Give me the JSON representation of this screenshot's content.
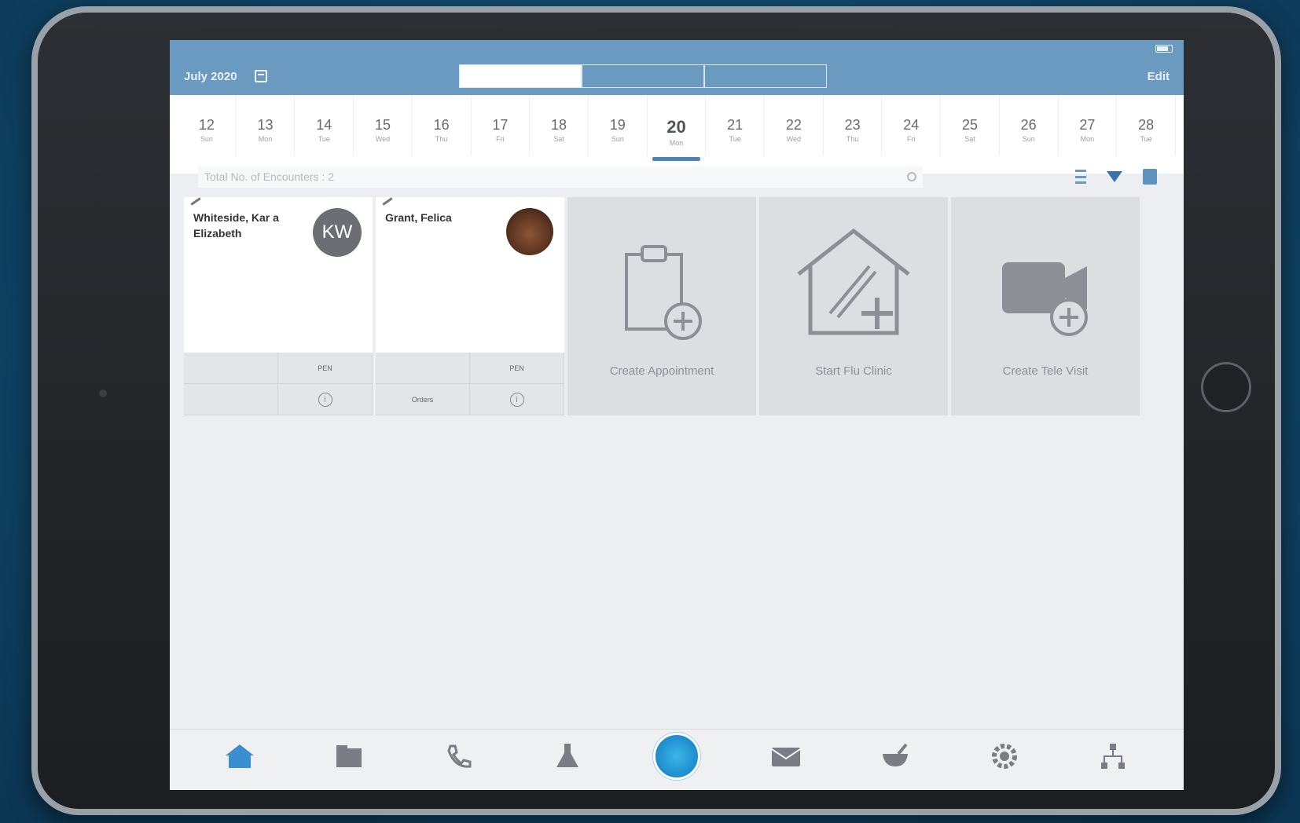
{
  "status_bar": {
    "time": "",
    "carrier": "",
    "battery": ""
  },
  "nav": {
    "title": "July 2020",
    "edit_label": "Edit",
    "segments": [
      "",
      "",
      ""
    ]
  },
  "dates": [
    {
      "num": "12",
      "day": "Sun"
    },
    {
      "num": "13",
      "day": "Mon"
    },
    {
      "num": "14",
      "day": "Tue"
    },
    {
      "num": "15",
      "day": "Wed"
    },
    {
      "num": "16",
      "day": "Thu"
    },
    {
      "num": "17",
      "day": "Fri"
    },
    {
      "num": "18",
      "day": "Sat"
    },
    {
      "num": "19",
      "day": "Sun"
    },
    {
      "num": "20",
      "day": "Mon"
    },
    {
      "num": "21",
      "day": "Tue"
    },
    {
      "num": "22",
      "day": "Wed"
    },
    {
      "num": "23",
      "day": "Thu"
    },
    {
      "num": "24",
      "day": "Fri"
    },
    {
      "num": "25",
      "day": "Sat"
    },
    {
      "num": "26",
      "day": "Sun"
    },
    {
      "num": "27",
      "day": "Mon"
    },
    {
      "num": "28",
      "day": "Tue"
    }
  ],
  "selected_date_index": 8,
  "search": {
    "placeholder": "Total No. of Encounters : 2"
  },
  "patients": [
    {
      "name": "Whiteside, Kar a Elizabeth",
      "initials": "KW",
      "sub1": "",
      "sub2": "",
      "tag": "",
      "meta": [
        "",
        "",
        ""
      ],
      "type": "",
      "foot": [
        "",
        "PEN",
        "",
        "i"
      ]
    },
    {
      "name": "Grant, Felica",
      "initials": "",
      "sub1": "",
      "sub2": "",
      "tag": "",
      "meta": [
        "",
        "",
        ""
      ],
      "type": "",
      "foot": [
        "",
        "PEN",
        "Orders",
        "i"
      ]
    }
  ],
  "actions": [
    {
      "label": "Create Appointment",
      "icon": "clipboard-add-icon"
    },
    {
      "label": "Start Flu Clinic",
      "icon": "house-syringe-icon"
    },
    {
      "label": "Create Tele Visit",
      "icon": "video-add-icon"
    }
  ],
  "tabs": [
    {
      "label": "",
      "icon": "home-icon",
      "badge": ""
    },
    {
      "label": "",
      "icon": "documents-icon",
      "badge": ""
    },
    {
      "label": "",
      "icon": "phone-icon",
      "badge": ""
    },
    {
      "label": "",
      "icon": "lab-flask-icon",
      "badge": ""
    },
    {
      "label": "",
      "icon": "ehr-center-icon",
      "badge": ""
    },
    {
      "label": "",
      "icon": "messages-icon",
      "badge": ""
    },
    {
      "label": "",
      "icon": "rx-icon",
      "badge": ""
    },
    {
      "label": "",
      "icon": "settings-icon",
      "badge": ""
    },
    {
      "label": "",
      "icon": "hierarchy-icon",
      "badge": ""
    }
  ],
  "center_tab_label": "",
  "colors": {
    "nav_blue": "#6a9ac0",
    "accent": "#4d84b3",
    "badge_red": "#e0282f",
    "center_blue": "#1d8ccd"
  }
}
